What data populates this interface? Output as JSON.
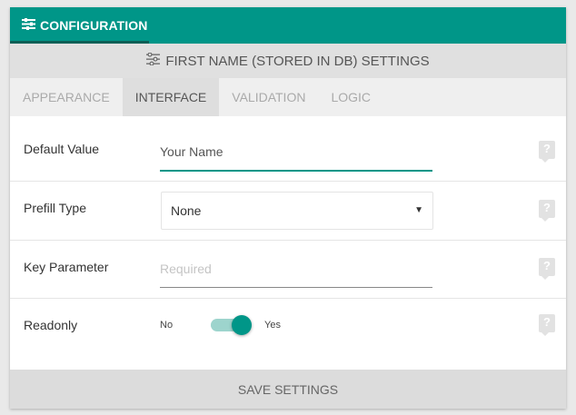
{
  "header": {
    "config_label": "CONFIGURATION",
    "settings_title": "FIRST NAME (STORED IN DB) SETTINGS",
    "accent_color": "#009688"
  },
  "tabs": [
    {
      "label": "APPEARANCE",
      "active": false
    },
    {
      "label": "INTERFACE",
      "active": true
    },
    {
      "label": "VALIDATION",
      "active": false
    },
    {
      "label": "LOGIC",
      "active": false
    }
  ],
  "fields": {
    "default_value": {
      "label": "Default Value",
      "value": "Your Name"
    },
    "prefill_type": {
      "label": "Prefill Type",
      "selected": "None"
    },
    "key_parameter": {
      "label": "Key Parameter",
      "value": "",
      "placeholder": "Required"
    },
    "readonly": {
      "label": "Readonly",
      "off_label": "No",
      "on_label": "Yes",
      "state": "on"
    }
  },
  "help_glyph": "?",
  "footer": {
    "save_label": "SAVE SETTINGS"
  }
}
